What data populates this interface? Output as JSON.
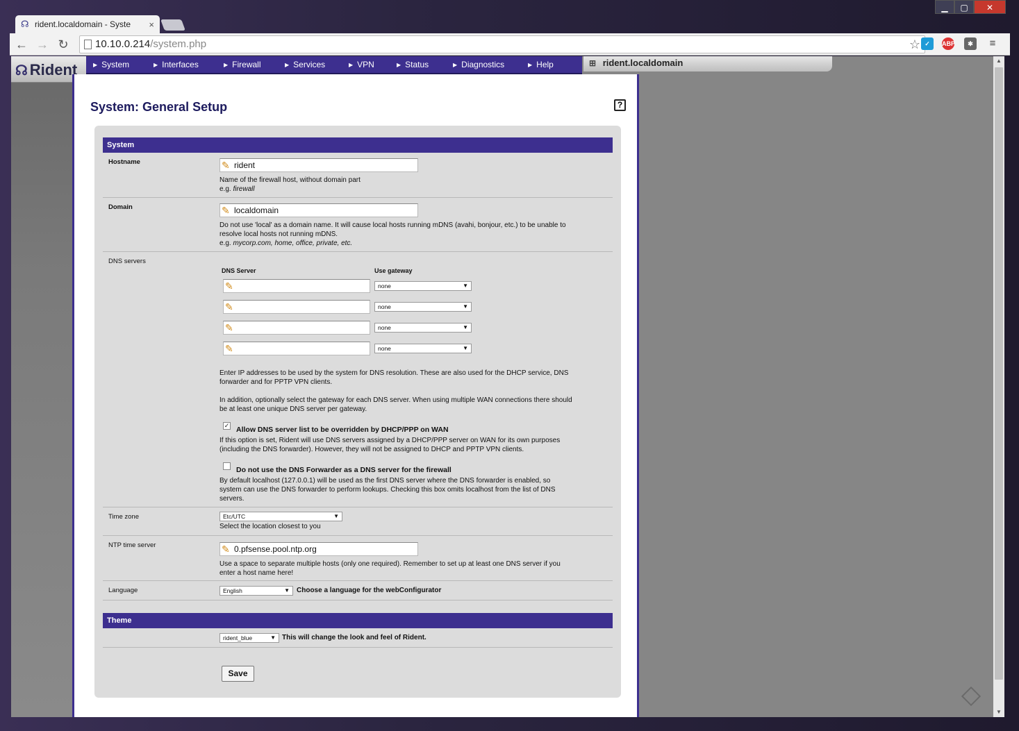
{
  "browser": {
    "tab_title": "rident.localdomain - Syste",
    "tab_close": "×",
    "url_host": "10.10.0.214",
    "url_path": "/system.php",
    "controls": {
      "minimize": "▁",
      "maximize": "▢",
      "close": "✕"
    },
    "extensions": [
      "ABP"
    ]
  },
  "app": {
    "logo_text": "Rident",
    "hostname_display": "rident.localdomain",
    "nav": [
      "System",
      "Interfaces",
      "Firewall",
      "Services",
      "VPN",
      "Status",
      "Diagnostics",
      "Help"
    ]
  },
  "page": {
    "title": "System: General Setup",
    "help": "?"
  },
  "system_section": {
    "header": "System",
    "hostname": {
      "label": "Hostname",
      "value": "rident",
      "desc": "Name of the firewall host, without domain part",
      "example_prefix": "e.g.",
      "example": "firewall"
    },
    "domain": {
      "label": "Domain",
      "value": "localdomain",
      "desc1": "Do not use 'local' as a domain name. It will cause local hosts running mDNS (avahi, bonjour, etc.) to be unable to",
      "desc2": "resolve local hosts not running mDNS.",
      "example_prefix": "e.g.",
      "example": "mycorp.com, home, office, private, etc."
    },
    "dns": {
      "label": "DNS servers",
      "col_server": "DNS Server",
      "col_gateway": "Use gateway",
      "servers": [
        "",
        "",
        "",
        ""
      ],
      "gateways": [
        "none",
        "none",
        "none",
        "none"
      ],
      "desc1a": "Enter IP addresses to be used by the system for DNS resolution. These are also used for the DHCP service, DNS",
      "desc1b": "forwarder and for PPTP VPN clients.",
      "desc2a": "In addition, optionally select the gateway for each DNS server. When using multiple WAN connections there should",
      "desc2b": "be at least one unique DNS server per gateway.",
      "override": {
        "checked": true,
        "label": "Allow DNS server list to be overridden by DHCP/PPP on WAN",
        "desc_a": "If this option is set, Rident will use DNS servers assigned by a DHCP/PPP server on WAN for its own purposes",
        "desc_b": "(including the DNS forwarder). However, they will not be assigned to DHCP and PPTP VPN clients."
      },
      "no_forwarder": {
        "checked": false,
        "label": "Do not use the DNS Forwarder as a DNS server for the firewall",
        "desc_a": "By default localhost (127.0.0.1) will be used as the first DNS server where the DNS forwarder is enabled, so",
        "desc_b": "system can use the DNS forwarder to perform lookups. Checking this box omits localhost from the list of DNS",
        "desc_c": "servers."
      }
    },
    "timezone": {
      "label": "Time zone",
      "value": "Etc/UTC",
      "desc": "Select the location closest to you"
    },
    "ntp": {
      "label": "NTP time server",
      "value": "0.pfsense.pool.ntp.org",
      "desc_a": "Use a space to separate multiple hosts (only one required). Remember to set up at least one DNS server if you",
      "desc_b": "enter a host name here!"
    },
    "language": {
      "label": "Language",
      "value": "English",
      "desc": "Choose a language for the webConfigurator"
    }
  },
  "theme_section": {
    "header": "Theme",
    "value": "rident_blue",
    "desc": "This will change the look and feel of Rident."
  },
  "save_label": "Save",
  "colors": {
    "nav": "#3d2f8f",
    "title": "#1d1b5e",
    "form_bg": "#dcdcdc"
  }
}
